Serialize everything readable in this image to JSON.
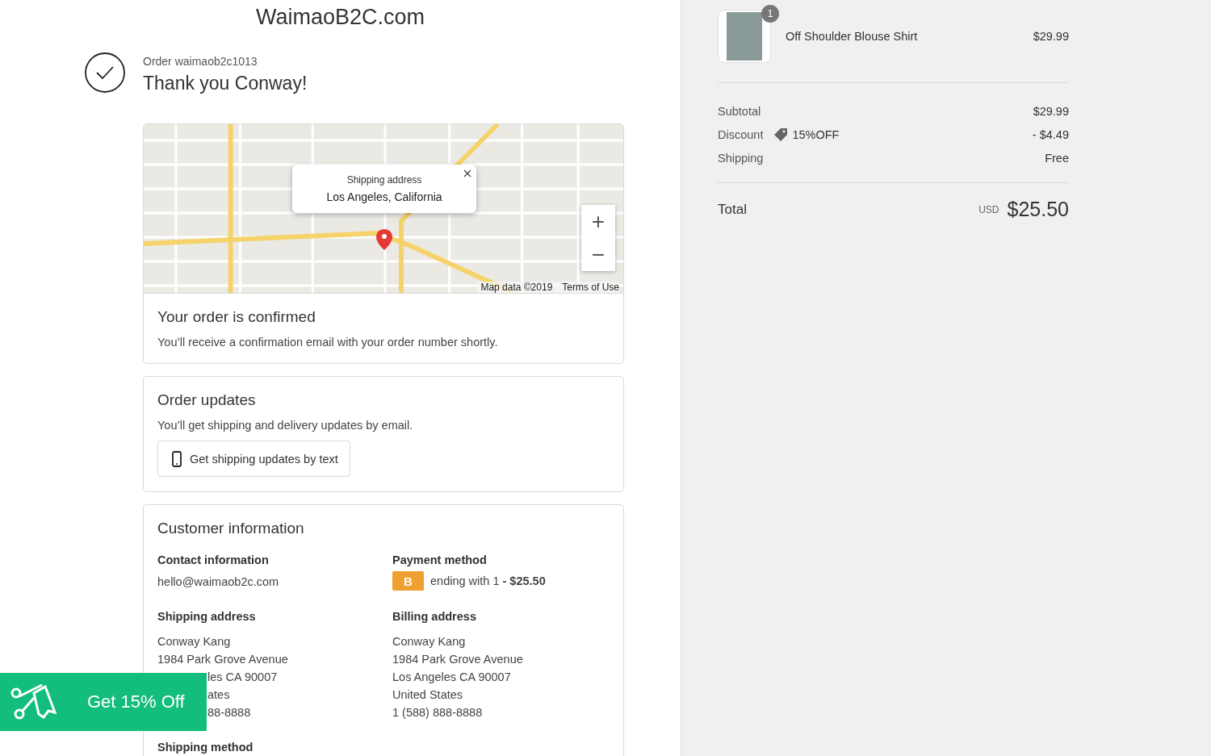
{
  "store": {
    "name": "WaimaoB2C.com"
  },
  "order": {
    "number": "Order waimaob2c1013",
    "thanks": "Thank you Conway!"
  },
  "map": {
    "popup": {
      "title": "Shipping address",
      "location": "Los Angeles, California"
    },
    "zoom_in": "+",
    "zoom_out": "−",
    "attribution": "Map data ©2019",
    "terms": "Terms of Use"
  },
  "confirmed": {
    "title": "Your order is confirmed",
    "text": "You’ll receive a confirmation email with your order number shortly."
  },
  "updates": {
    "title": "Order updates",
    "text": "You’ll get shipping and delivery updates by email.",
    "button": "Get shipping updates by text"
  },
  "customer": {
    "title": "Customer information",
    "contact": {
      "label": "Contact information",
      "value": "hello@waimaob2c.com"
    },
    "payment": {
      "label": "Payment method",
      "badge": "B",
      "text": "ending with 1 **- $25.50**"
    },
    "shipping_address": {
      "label": "Shipping address",
      "lines": [
        "Conway Kang",
        "1984 Park Grove Avenue"
      ],
      "partly_hidden_lines": [
        "les CA 90007",
        "ates",
        "88-8888"
      ]
    },
    "billing_address": {
      "label": "Billing address",
      "lines": [
        "Conway Kang",
        "1984 Park Grove Avenue",
        "Los Angeles CA 90007",
        "United States",
        "1 (588) 888-8888"
      ]
    },
    "shipping_method": {
      "label": "Shipping method"
    }
  },
  "promo": {
    "label": "Get 15% Off"
  },
  "summary": {
    "items": [
      {
        "name": "Off Shoulder Blouse Shirt",
        "quantity": "1",
        "price": "$29.99"
      }
    ],
    "subtotal": {
      "label": "Subtotal",
      "value": "$29.99"
    },
    "discount": {
      "label": "Discount",
      "code": "15%OFF",
      "value": "- $4.49"
    },
    "shipping": {
      "label": "Shipping",
      "value": "Free"
    },
    "total": {
      "label": "Total",
      "currency": "USD",
      "value": "$25.50"
    }
  }
}
